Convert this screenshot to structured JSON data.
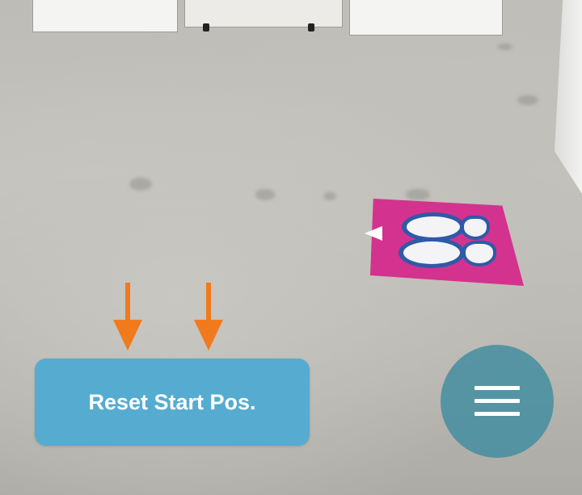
{
  "reset_button": {
    "label": "Reset Start Pos."
  },
  "menu_button": {
    "icon": "hamburger-menu-icon"
  },
  "guide_arrows": {
    "icon": "arrow-down-icon",
    "count": 2,
    "color": "#f07a1c"
  },
  "direction_marker": {
    "icon": "triangle-left-icon",
    "color": "#ffffff"
  },
  "floor_mat": {
    "color": "#d4328f",
    "footprint_color": "#2e5aa8"
  },
  "colors": {
    "button_bg": "#55acd0",
    "button_text": "#ffffff",
    "menu_bg": "#408ca0"
  }
}
